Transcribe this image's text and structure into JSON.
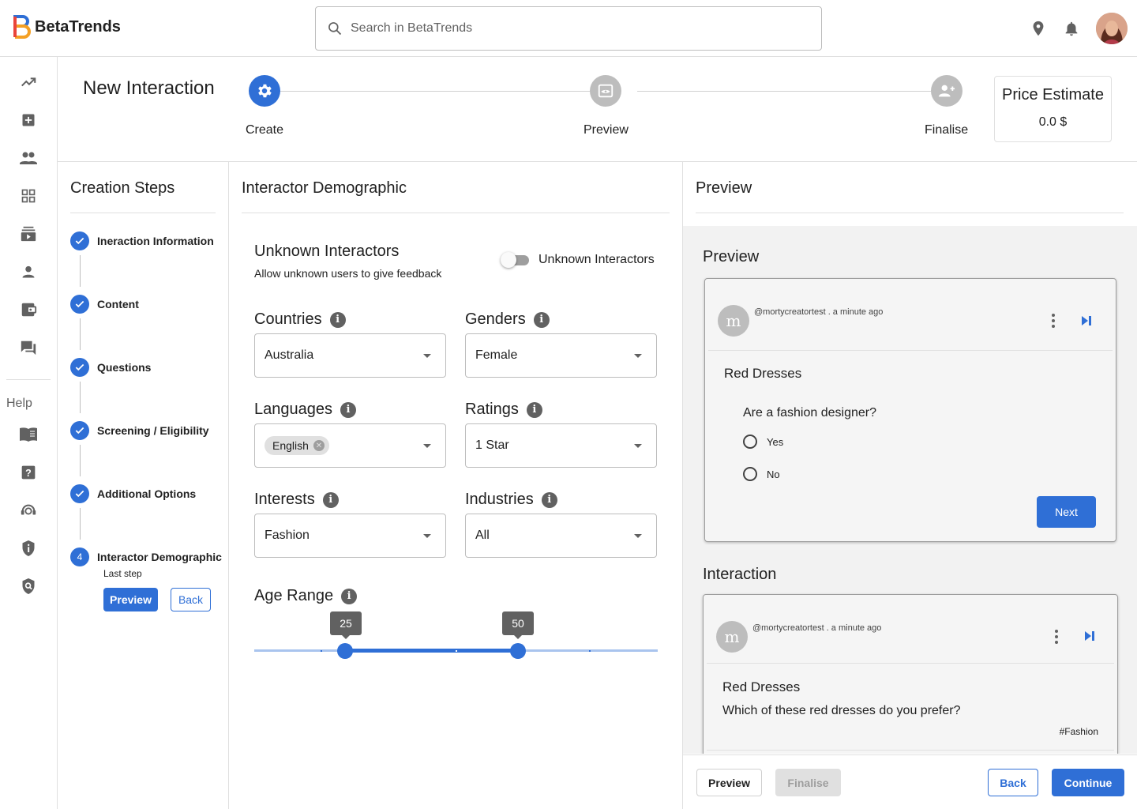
{
  "app": {
    "name": "BetaTrends"
  },
  "search": {
    "placeholder": "Search in BetaTrends"
  },
  "sidebar": {
    "help_label": "Help"
  },
  "header": {
    "title": "New Interaction",
    "steps": [
      {
        "label": "Create"
      },
      {
        "label": "Preview"
      },
      {
        "label": "Finalise"
      }
    ],
    "price": {
      "title": "Price Estimate",
      "value": "0.0 $"
    }
  },
  "creation_steps": {
    "title": "Creation Steps",
    "items": [
      {
        "label": "Ineraction Information"
      },
      {
        "label": "Content"
      },
      {
        "label": "Questions"
      },
      {
        "label": "Screening / Eligibility"
      },
      {
        "label": "Additional Options"
      }
    ],
    "current": {
      "number": "4",
      "label": "Interactor Demographic",
      "sub": "Last step"
    },
    "preview_button": "Preview",
    "back_button": "Back"
  },
  "demographic": {
    "title": "Interactor Demographic",
    "unknown": {
      "title": "Unknown Interactors",
      "subtitle": "Allow unknown users to give feedback",
      "toggle_label": "Unknown Interactors",
      "enabled": false
    },
    "countries": {
      "label": "Countries",
      "value": "Australia"
    },
    "genders": {
      "label": "Genders",
      "value": "Female"
    },
    "languages": {
      "label": "Languages",
      "chip": "English"
    },
    "ratings": {
      "label": "Ratings",
      "value": "1 Star"
    },
    "interests": {
      "label": "Interests",
      "value": "Fashion"
    },
    "industries": {
      "label": "Industries",
      "value": "All"
    },
    "age_range": {
      "label": "Age Range",
      "min": "25",
      "max": "50"
    }
  },
  "preview": {
    "title": "Preview",
    "section_title": "Preview",
    "card": {
      "avatar": "m",
      "meta": "@mortycreatortest . a minute ago",
      "title": "Red Dresses",
      "question": "Are a fashion designer?",
      "options": [
        "Yes",
        "No"
      ],
      "next_button": "Next"
    },
    "interaction_title": "Interaction",
    "interaction_card": {
      "avatar": "m",
      "meta": "@mortycreatortest . a minute ago",
      "title": "Red Dresses",
      "question": "Which of these red dresses do you prefer?",
      "tag": "#Fashion"
    }
  },
  "footer": {
    "preview": "Preview",
    "finalise": "Finalise",
    "back": "Back",
    "continue": "Continue"
  },
  "colors": {
    "primary": "#2f6fd6",
    "text": "#212121",
    "muted": "#616161",
    "border": "#e0e0e0"
  }
}
